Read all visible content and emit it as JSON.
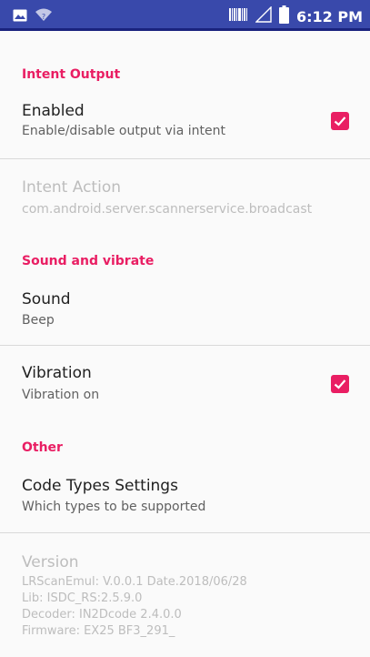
{
  "status_bar": {
    "time": "6:12 PM",
    "icons": [
      "image-icon",
      "wifi-icon",
      "barcode-icon",
      "signal-icon",
      "battery-icon"
    ]
  },
  "colors": {
    "accent": "#e91e63",
    "status_bar": "#3949ab",
    "disabled_text": "#bdbdbd"
  },
  "sections": {
    "intent_output": {
      "header": "Intent Output",
      "enabled": {
        "title": "Enabled",
        "summary": "Enable/disable output via intent",
        "checked": true
      },
      "intent_action": {
        "title": "Intent Action",
        "summary": "com.android.server.scannerservice.broadcast"
      }
    },
    "sound_vibrate": {
      "header": "Sound and vibrate",
      "sound": {
        "title": "Sound",
        "summary": "Beep"
      },
      "vibration": {
        "title": "Vibration",
        "summary": "Vibration on",
        "checked": true
      }
    },
    "other": {
      "header": "Other",
      "code_types": {
        "title": "Code Types Settings",
        "summary": "Which types to be supported"
      },
      "version": {
        "title": "Version",
        "lines": [
          "LRScanEmul: V.0.0.1 Date.2018/06/28",
          "Lib: ISDC_RS:2.5.9.0",
          "Decoder: IN2Dcode 2.4.0.0",
          "Firmware: EX25 BF3_291_"
        ]
      }
    }
  }
}
